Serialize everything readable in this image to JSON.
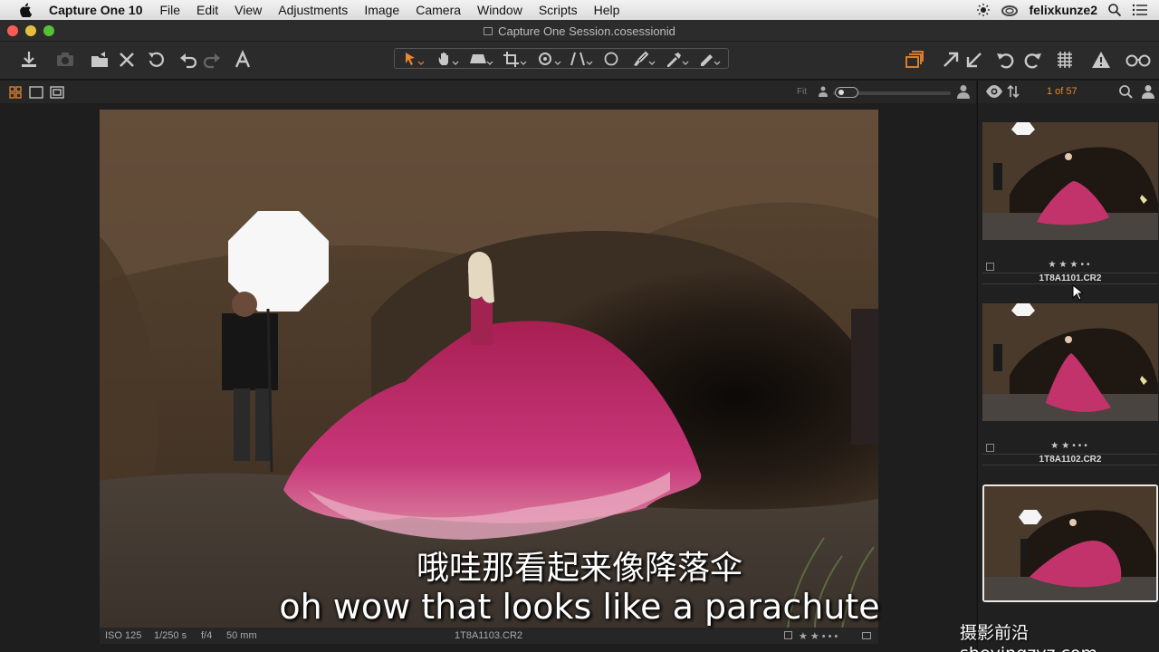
{
  "menubar": {
    "app_name": "Capture One 10",
    "items": [
      "File",
      "Edit",
      "View",
      "Adjustments",
      "Image",
      "Camera",
      "Window",
      "Scripts",
      "Help"
    ],
    "user": "felixkunze2"
  },
  "window": {
    "title": "Capture One Session.cosessionid"
  },
  "viewer": {
    "fit_label": "Fit",
    "info": {
      "iso": "ISO 125",
      "shutter": "1/250 s",
      "aperture": "f/4",
      "focal": "50 mm",
      "filename": "1T8A1103.CR2"
    }
  },
  "browser": {
    "count": "1 of 57",
    "thumbnails": [
      {
        "filename": "1T8A1101.CR2",
        "rating": 3
      },
      {
        "filename": "1T8A1102.CR2",
        "rating": 2
      },
      {
        "filename": "",
        "rating": 0,
        "selected": true
      }
    ]
  },
  "subtitles": {
    "chinese": "哦哇那看起来像降落伞",
    "english": "oh wow that looks like a parachute"
  },
  "watermark": "摄影前沿 sheyingzyz.com",
  "colors": {
    "accent": "#e8872e",
    "dress": "#c2336b"
  }
}
